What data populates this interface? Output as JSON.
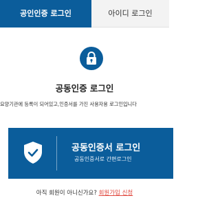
{
  "tabs": [
    {
      "label": "공인인증 로그인",
      "active": true
    },
    {
      "label": "아이디 로그인",
      "active": false
    }
  ],
  "icons": {
    "lock": "lock-icon",
    "shield": "shield-check-icon"
  },
  "colors": {
    "primary": "#0b5d9b",
    "link": "#e0483e"
  },
  "heading": "공동인증 로그인",
  "description": "요양기관에 등록이 되어있고,인증서를 가진 사용자용 로그인입니다",
  "cert_button": {
    "title": "공동인증서 로그인",
    "subtitle": "공동인증서로 간편로그인"
  },
  "signup": {
    "prompt": "아직 회원이 아니신가요?",
    "link": "회원가입 신청"
  }
}
